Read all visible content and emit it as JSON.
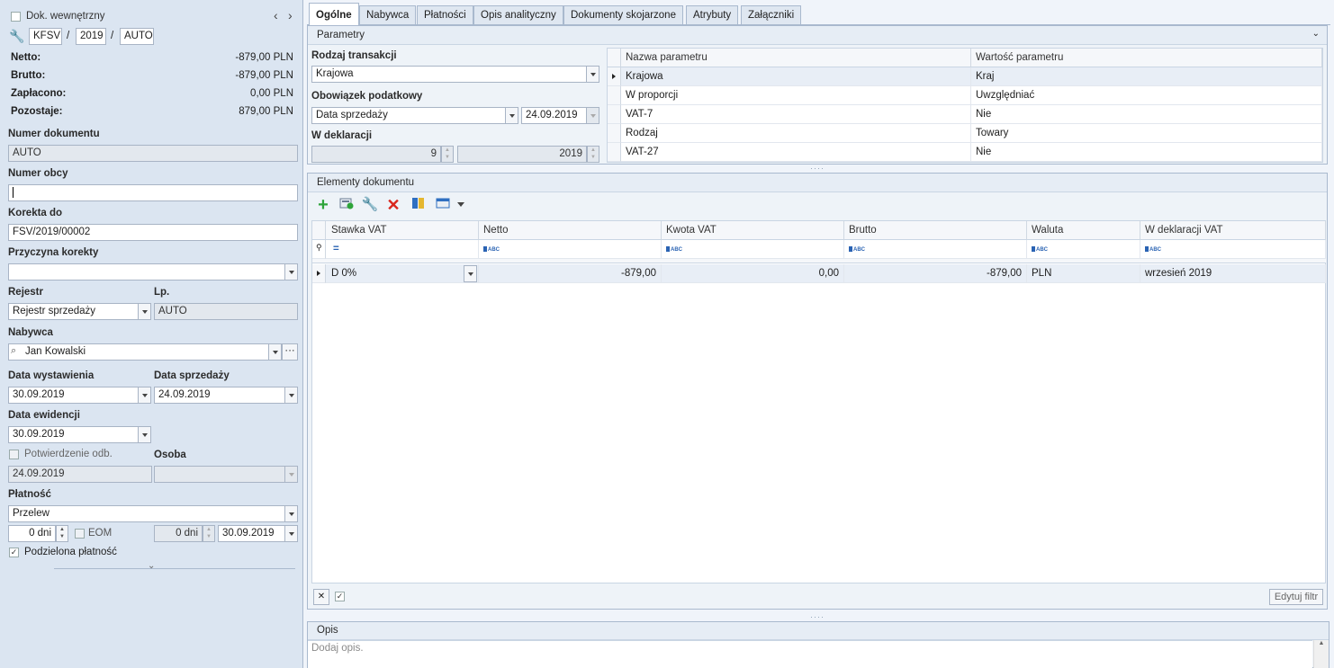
{
  "left": {
    "doc_internal_label": "Dok. wewnętrzny",
    "doc_number_parts": [
      "KFSV",
      "2019",
      "AUTO"
    ],
    "separator": "/",
    "summary": [
      {
        "label": "Netto:",
        "value": "-879,00 PLN"
      },
      {
        "label": "Brutto:",
        "value": "-879,00 PLN"
      },
      {
        "label": "Zapłacono:",
        "value": "0,00 PLN"
      },
      {
        "label": "Pozostaje:",
        "value": "879,00 PLN"
      }
    ],
    "numer_dokumentu": {
      "label": "Numer dokumentu",
      "value": "AUTO"
    },
    "numer_obcy": {
      "label": "Numer obcy",
      "value": ""
    },
    "korekta_do": {
      "label": "Korekta do",
      "value": "FSV/2019/00002"
    },
    "przyczyna_korekty": {
      "label": "Przyczyna korekty",
      "value": ""
    },
    "rejestr": {
      "label": "Rejestr",
      "value": "Rejestr sprzedaży"
    },
    "lp": {
      "label": "Lp.",
      "value": "AUTO"
    },
    "nabywca": {
      "label": "Nabywca",
      "value": "Jan Kowalski",
      "more": "···"
    },
    "data_wystawienia": {
      "label": "Data wystawienia",
      "value": "30.09.2019"
    },
    "data_sprzedazy": {
      "label": "Data sprzedaży",
      "value": "24.09.2019"
    },
    "data_ewidencji": {
      "label": "Data ewidencji",
      "value": "30.09.2019"
    },
    "potwierdzenie": {
      "label": "Potwierdzenie odb.",
      "value": "24.09.2019"
    },
    "osoba": {
      "label": "Osoba",
      "value": ""
    },
    "platnosc": {
      "label": "Płatność",
      "value": "Przelew"
    },
    "termin_dni": "0 dni",
    "eom_label": "EOM",
    "termin_dni2": "0 dni",
    "termin_data": "30.09.2019",
    "podzielona_label": "Podzielona płatność"
  },
  "tabs": [
    "Ogólne",
    "Nabywca",
    "Płatności",
    "Opis analityczny",
    "Dokumenty skojarzone",
    "Atrybuty",
    "Załączniki"
  ],
  "parametry": {
    "title": "Parametry",
    "rodzaj_label": "Rodzaj transakcji",
    "rodzaj_value": "Krajowa",
    "obowiazek_label": "Obowiązek podatkowy",
    "obowiazek_value": "Data sprzedaży",
    "obowiazek_date": "24.09.2019",
    "deklaracja_label": "W deklaracji",
    "deklaracja_month": "9",
    "deklaracja_year": "2019",
    "columns": [
      "Nazwa parametru",
      "Wartość parametru"
    ],
    "rows": [
      [
        "Krajowa",
        "Kraj"
      ],
      [
        "W proporcji",
        "Uwzględniać"
      ],
      [
        "VAT-7",
        "Nie"
      ],
      [
        "Rodzaj",
        "Towary"
      ],
      [
        "VAT-27",
        "Nie"
      ]
    ]
  },
  "elementy": {
    "title": "Elementy dokumentu",
    "columns": [
      "Stawka VAT",
      "Netto",
      "Kwota VAT",
      "Brutto",
      "Waluta",
      "W deklaracji VAT"
    ],
    "filter_eq": "=",
    "filter_abc": "ABC",
    "rows": [
      [
        "D 0%",
        "-879,00",
        "0,00",
        "-879,00",
        "PLN",
        "wrzesień 2019"
      ]
    ],
    "edit_filter": "Edytuj filtr"
  },
  "opis": {
    "title": "Opis",
    "placeholder": "Dodaj opis."
  }
}
